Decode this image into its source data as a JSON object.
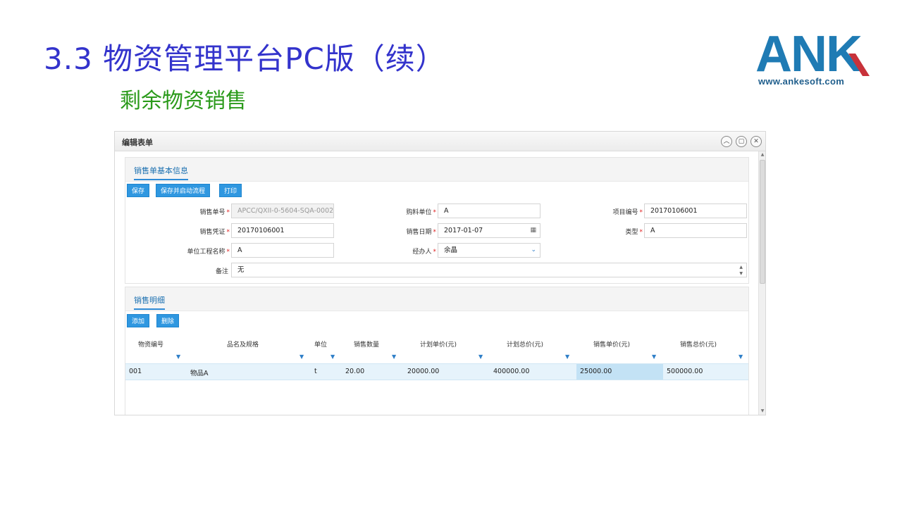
{
  "slide": {
    "title": "3.3 物资管理平台PC版（续）",
    "subtitle": "剩余物资销售",
    "logo_text": "ANK",
    "logo_url": "www.ankesoft.com",
    "colors": {
      "title": "#3333cc",
      "subtitle": "#2a9a1a",
      "logo": "#1f7bb4",
      "logo_accent": "#c8323a",
      "button": "#2f97e0"
    }
  },
  "window": {
    "title": "编辑表单",
    "controls": {
      "collapse": "chevron-up-icon",
      "maximize": "restore-icon",
      "close": "close-icon"
    }
  },
  "basic_info": {
    "tab": "销售单基本信息",
    "buttons": {
      "save": "保存",
      "save_start": "保存并启动流程",
      "print": "打印"
    },
    "fields": {
      "sale_no": {
        "label": "销售单号",
        "value": "APCC/QXII-0-5604-SQA-0002"
      },
      "buyer": {
        "label": "购料单位",
        "value": "A"
      },
      "project_no": {
        "label": "项目编号",
        "value": "20170106001"
      },
      "voucher": {
        "label": "销售凭证",
        "value": "20170106001"
      },
      "sale_date": {
        "label": "销售日期",
        "value": "2017-01-07"
      },
      "type": {
        "label": "类型",
        "value": "A"
      },
      "project_name": {
        "label": "单位工程名称",
        "value": "A"
      },
      "handler": {
        "label": "经办人",
        "value": "余晶"
      },
      "remark": {
        "label": "备注",
        "value": "无"
      }
    },
    "required_mark": "*"
  },
  "details": {
    "tab": "销售明细",
    "buttons": {
      "add": "添加",
      "delete": "删除"
    },
    "columns": [
      "物资编号",
      "品名及规格",
      "单位",
      "销售数量",
      "计划单价(元)",
      "计划总价(元)",
      "销售单价(元)",
      "销售总价(元)"
    ],
    "rows": [
      [
        "001",
        "物品A",
        "t",
        "20.00",
        "20000.00",
        "400000.00",
        "25000.00",
        "500000.00"
      ]
    ]
  }
}
